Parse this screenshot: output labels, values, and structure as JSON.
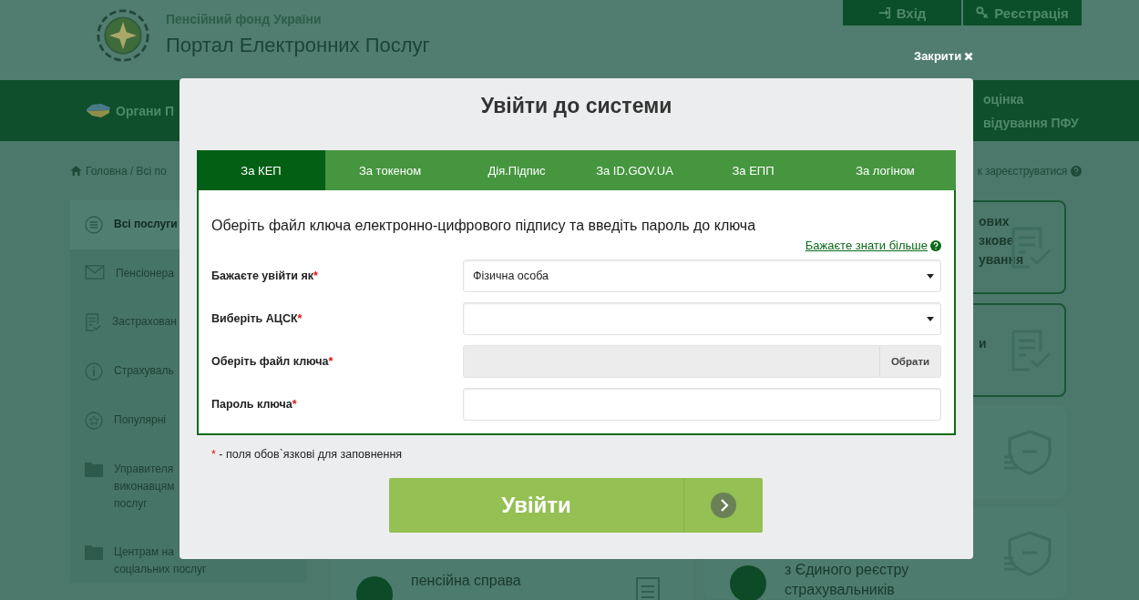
{
  "header": {
    "org": "Пенсійний фонд України",
    "portal": "Портал Електронних Послуг",
    "login": "Вхід",
    "register": "Реєстрація"
  },
  "nav": {
    "left": "Органи П",
    "right_lines": [
      "оцінка",
      "відування ПФУ"
    ]
  },
  "breadcrumb": {
    "home": "Головна / Всі по",
    "register_help": "к зареєструватися"
  },
  "sidebar": {
    "items": [
      {
        "label": "Всі послуги",
        "selected": true
      },
      {
        "label": "Пенсіонера",
        "selected": false
      },
      {
        "label": "Застрахован",
        "selected": false
      },
      {
        "label": "Страхуваль",
        "selected": false
      },
      {
        "label": "Популярні",
        "selected": false
      },
      {
        "label": "Управителя\nвиконавцям\nпослуг",
        "selected": false
      },
      {
        "label": "Центрам на\nсоціальних послуг",
        "selected": false
      }
    ]
  },
  "cards": {
    "left": [
      {
        "kind": "round",
        "lines": [
          "пенсійна справа"
        ]
      }
    ],
    "right": [
      {
        "kind": "bordered",
        "lines": [
          "ових",
          "зкове",
          "ування"
        ]
      },
      {
        "kind": "bordered",
        "lines": [
          "и"
        ]
      },
      {
        "kind": "plain"
      },
      {
        "kind": "round",
        "lines": [
          "з Єдиного реєстру",
          "страхувальників"
        ]
      }
    ]
  },
  "modal": {
    "close": "Закрити",
    "title": "Увійти до системи",
    "tabs": [
      {
        "label": "За КЕП",
        "selected": true
      },
      {
        "label": "За токеном",
        "selected": false
      },
      {
        "label": "Дія.Підпис",
        "selected": false
      },
      {
        "label": "За ID.GOV.UA",
        "selected": false
      },
      {
        "label": "За ЕПП",
        "selected": false
      },
      {
        "label": "За логіном",
        "selected": false
      }
    ],
    "heading": "Оберіть файл ключа електронно-цифрового підпису та введіть пароль до ключа",
    "help_link": "Бажаєте знати більше",
    "fields": [
      {
        "kind": "select",
        "label": "Бажаєте увійти як",
        "required": true,
        "value": "Фізична особа"
      },
      {
        "kind": "select",
        "label": "Виберіть АЦСК",
        "required": true
      },
      {
        "kind": "file",
        "label": "Оберіть файл ключа",
        "required": true,
        "button": "Обрати"
      },
      {
        "kind": "password",
        "label": "Пароль ключа",
        "required": true
      }
    ],
    "required_note": "- поля обов`язкові для заповнення",
    "required_mark": "*",
    "submit": "Увійти"
  }
}
